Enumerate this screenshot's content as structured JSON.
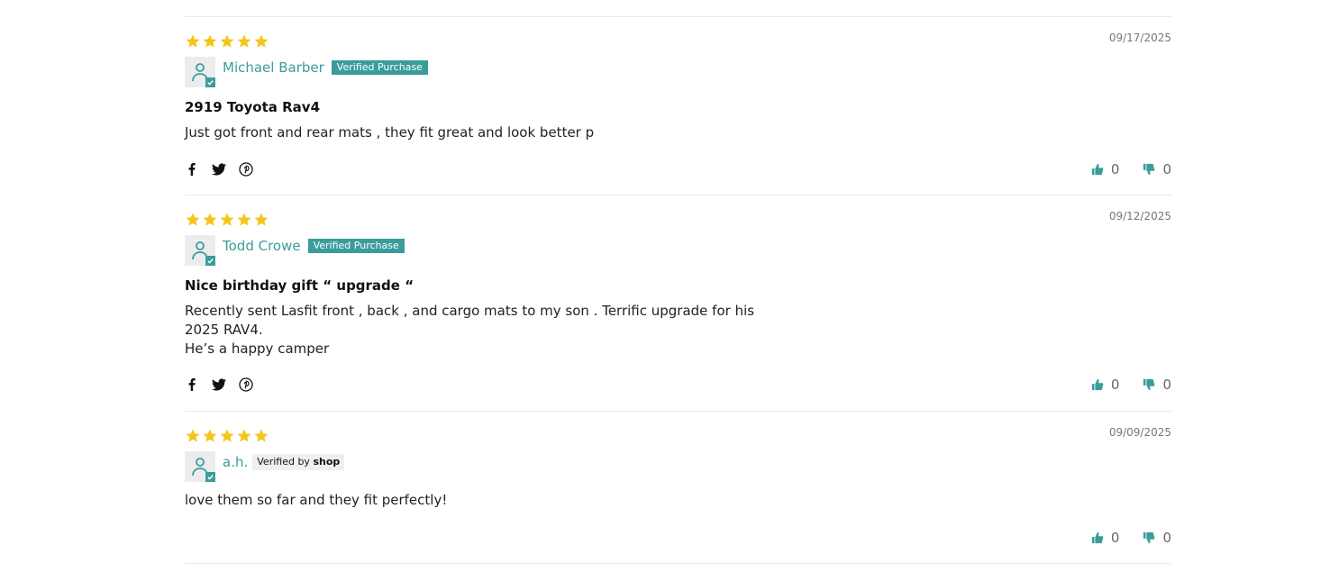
{
  "colors": {
    "accent": "#3a9d9a",
    "star": "#f5c518"
  },
  "reviews": [
    {
      "rating": 5,
      "date": "09/17/2025",
      "name": "Michael Barber",
      "badge": "Verified Purchase",
      "title": "2919 Toyota Rav4",
      "body": "Just got front and rear mats , they fit great and look better p",
      "thumbs_up": "0",
      "thumbs_down": "0"
    },
    {
      "rating": 5,
      "date": "09/12/2025",
      "name": "Todd Crowe",
      "badge": "Verified Purchase",
      "title": "Nice birthday gift “ upgrade “",
      "body": "Recently sent Lasfit front , back , and cargo mats to my son . Terrific upgrade for his\n2025 RAV4.\nHe’s a happy camper",
      "thumbs_up": "0",
      "thumbs_down": "0"
    },
    {
      "rating": 5,
      "date": "09/09/2025",
      "name": "a.h.",
      "badge_prefix": "Verified by",
      "badge_brand": "shop",
      "body": "love them so far and they fit perfectly!",
      "thumbs_up": "0",
      "thumbs_down": "0"
    }
  ],
  "share_icons": [
    "facebook-icon",
    "twitter-icon",
    "pinterest-icon"
  ],
  "vote_icons": [
    "thumbs-up-icon",
    "thumbs-down-icon"
  ]
}
